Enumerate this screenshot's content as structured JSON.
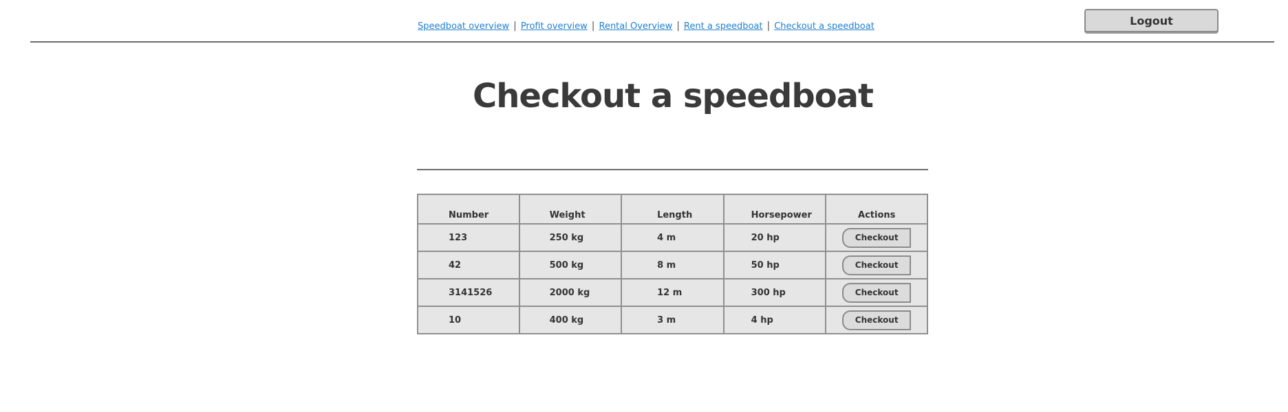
{
  "nav": {
    "links": [
      "Speedboat overview",
      "Profit overview",
      "Rental Overview",
      "Rent a speedboat",
      "Checkout a speedboat"
    ],
    "separator": "|"
  },
  "header": {
    "logout_label": "Logout"
  },
  "main": {
    "title": "Checkout a speedboat"
  },
  "table": {
    "headers": [
      "Number",
      "Weight",
      "Length",
      "Horsepower",
      "Actions"
    ],
    "rows": [
      {
        "number": "123",
        "weight": "250 kg",
        "length": "4 m",
        "horsepower": "20 hp",
        "action": "Checkout"
      },
      {
        "number": "42",
        "weight": "500 kg",
        "length": "8 m",
        "horsepower": "50 hp",
        "action": "Checkout"
      },
      {
        "number": "3141526",
        "weight": "2000 kg",
        "length": "12 m",
        "horsepower": "300 hp",
        "action": "Checkout"
      },
      {
        "number": "10",
        "weight": "400 kg",
        "length": "3 m",
        "horsepower": "4 hp",
        "action": "Checkout"
      }
    ]
  },
  "colors": {
    "link": "#1f7fd0",
    "text": "#3a3a3a",
    "table_bg": "#e6e6e6",
    "border": "#8f8f8f"
  }
}
